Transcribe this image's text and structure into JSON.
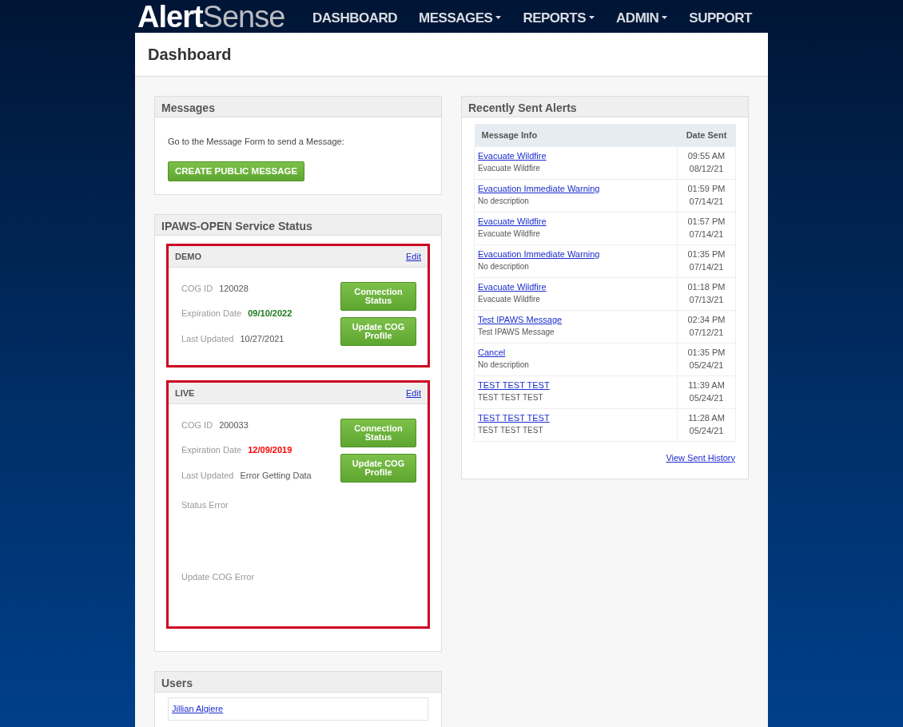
{
  "brand": {
    "logo_primary": "Alert",
    "logo_secondary": "Sense"
  },
  "nav": [
    {
      "label": "DASHBOARD",
      "dropdown": false
    },
    {
      "label": "MESSAGES",
      "dropdown": true
    },
    {
      "label": "REPORTS",
      "dropdown": true
    },
    {
      "label": "ADMIN",
      "dropdown": true
    },
    {
      "label": "SUPPORT",
      "dropdown": false
    }
  ],
  "page_title": "Dashboard",
  "messages_panel": {
    "title": "Messages",
    "prompt": "Go to the Message Form to send a Message:",
    "button": "CREATE PUBLIC MESSAGE"
  },
  "service_status": {
    "title": "IPAWS-OPEN Service Status",
    "environments": [
      {
        "name": "DEMO",
        "edit": "Edit",
        "cog_id": {
          "label": "COG ID",
          "value": "120028"
        },
        "expiration": {
          "label": "Expiration Date",
          "value": "09/10/2022",
          "expired": false
        },
        "last_updated": {
          "label": "Last Updated",
          "value": "10/27/2021"
        },
        "buttons": [
          "Connection Status",
          "Update COG Profile"
        ]
      },
      {
        "name": "LIVE",
        "edit": "Edit",
        "cog_id": {
          "label": "COG ID",
          "value": "200033"
        },
        "expiration": {
          "label": "Expiration Date",
          "value": "12/09/2019",
          "expired": true
        },
        "last_updated": {
          "label": "Last Updated",
          "value": "Error Getting Data"
        },
        "buttons": [
          "Connection Status",
          "Update COG Profile"
        ],
        "error_labels": [
          "Status Error",
          "Update COG Error"
        ]
      }
    ]
  },
  "users_panel": {
    "title": "Users",
    "users": [
      "Jillian Algiere"
    ]
  },
  "alerts_panel": {
    "title": "Recently Sent Alerts",
    "columns": [
      "Message Info",
      "Date Sent"
    ],
    "rows": [
      {
        "title": "Evacuate Wildfire",
        "description": "Evacuate Wildfire",
        "time": "09:55 AM",
        "date": "08/12/21"
      },
      {
        "title": "Evacuation Immediate Warning",
        "description": "No description",
        "time": "01:59 PM",
        "date": "07/14/21"
      },
      {
        "title": "Evacuate Wildfire",
        "description": "Evacuate Wildfire",
        "time": "01:57 PM",
        "date": "07/14/21"
      },
      {
        "title": "Evacuation Immediate Warning",
        "description": "No description",
        "time": "01:35 PM",
        "date": "07/14/21"
      },
      {
        "title": "Evacuate Wildfire",
        "description": "Evacuate Wildfire",
        "time": "01:18 PM",
        "date": "07/13/21"
      },
      {
        "title": "Test IPAWS Message",
        "description": "Test IPAWS Message",
        "time": "02:34 PM",
        "date": "07/12/21"
      },
      {
        "title": "Cancel",
        "description": "No description",
        "time": "01:35 PM",
        "date": "05/24/21"
      },
      {
        "title": "TEST TEST TEST",
        "description": "TEST TEST TEST",
        "time": "11:39 AM",
        "date": "05/24/21"
      },
      {
        "title": "TEST TEST TEST",
        "description": "TEST TEST TEST",
        "time": "11:28 AM",
        "date": "05/24/21"
      }
    ],
    "history_link": "View Sent History"
  }
}
